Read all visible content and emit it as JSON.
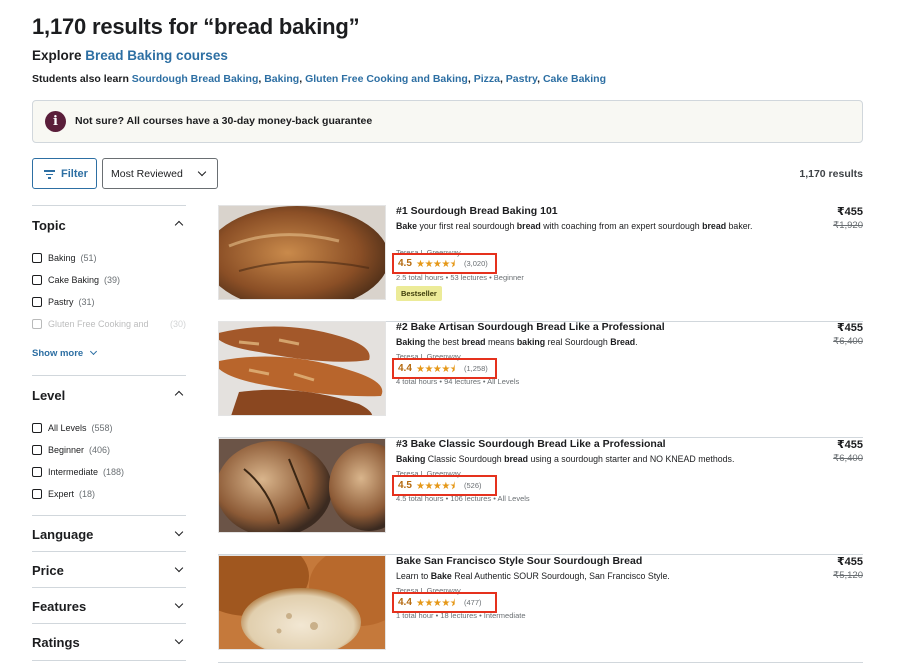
{
  "header": {
    "title": "1,170 results for “bread baking”",
    "explore_prefix": "Explore ",
    "explore_link": "Bread Baking courses",
    "also_learn_prefix": "Students also learn ",
    "also_learn": [
      "Sourdough Bread Baking",
      "Baking",
      "Gluten Free Cooking and Baking",
      "Pizza",
      "Pastry",
      "Cake Baking"
    ]
  },
  "guarantee": {
    "icon": "info-icon",
    "text": "Not sure? All courses have a 30-day money-back guarantee"
  },
  "toolbar": {
    "filter_label": "Filter",
    "sort_value": "Most Reviewed",
    "results_count": "1,170 results"
  },
  "sidebar": {
    "topic": {
      "title": "Topic",
      "options": [
        {
          "label": "Baking",
          "count": "(51)"
        },
        {
          "label": "Cake Baking",
          "count": "(39)"
        },
        {
          "label": "Pastry",
          "count": "(31)"
        },
        {
          "label": "Gluten Free Cooking and",
          "count": "(30)"
        }
      ],
      "show_more": "Show more"
    },
    "level": {
      "title": "Level",
      "options": [
        {
          "label": "All Levels",
          "count": "(558)"
        },
        {
          "label": "Beginner",
          "count": "(406)"
        },
        {
          "label": "Intermediate",
          "count": "(188)"
        },
        {
          "label": "Expert",
          "count": "(18)"
        }
      ]
    },
    "collapsed": [
      "Language",
      "Price",
      "Features",
      "Ratings"
    ]
  },
  "courses": [
    {
      "title": "#1 Sourdough Bread Baking 101",
      "desc_html": "<b>Bake</b> your first real sourdough <b>bread</b> with coaching from an expert sourdough <b>bread</b> baker.",
      "instructor": "Teresa L Greenway",
      "rating": "4.5",
      "stars": "★★★★⯨",
      "reviews": "(3,020)",
      "meta": "2.5 total hours • 53 lectures • Beginner",
      "badge": "Bestseller",
      "price": "₹455",
      "original_price": "₹1,920"
    },
    {
      "title": "#2 Bake Artisan Sourdough Bread Like a Professional",
      "desc_html": "<b>Baking</b> the best <b>bread</b> means <b>baking</b> real Sourdough <b>Bread</b>.",
      "instructor": "Teresa L Greenway",
      "rating": "4.4",
      "stars": "★★★★⯨",
      "reviews": "(1,258)",
      "meta": "4 total hours • 94 lectures • All Levels",
      "price": "₹455",
      "original_price": "₹6,400"
    },
    {
      "title": "#3 Bake Classic Sourdough Bread Like a Professional",
      "desc_html": "<b>Baking</b> Classic Sourdough <b>bread</b> using a sourdough starter and NO KNEAD methods.",
      "instructor": "Teresa L Greenway",
      "rating": "4.5",
      "stars": "★★★★⯨",
      "reviews": "(526)",
      "meta": "4.5 total hours • 106 lectures • All Levels",
      "price": "₹455",
      "original_price": "₹6,400"
    },
    {
      "title": "Bake San Francisco Style Sour Sourdough Bread",
      "desc_html": "Learn to <b>Bake</b> Real Authentic SOUR Sourdough, San Francisco Style.",
      "instructor": "Teresa L Greenway",
      "rating": "4.4",
      "stars": "★★★★⯨",
      "reviews": "(477)",
      "meta": "1 total hour • 18 lectures • Intermediate",
      "price": "₹455",
      "original_price": "₹5,120"
    }
  ]
}
